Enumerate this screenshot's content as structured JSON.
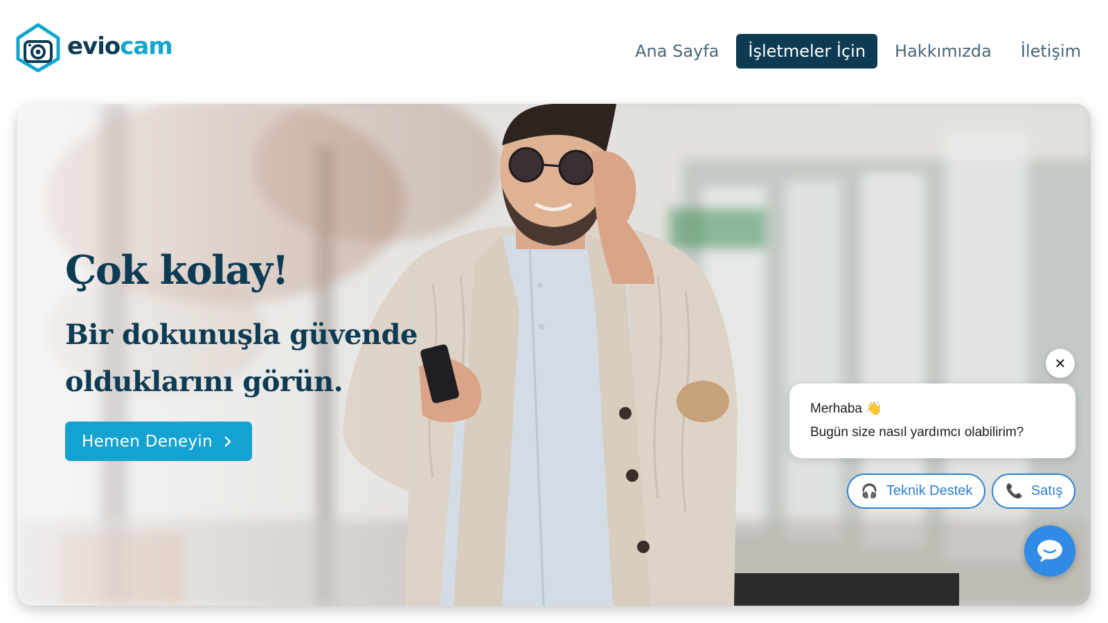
{
  "brand": {
    "name_part1": "evio",
    "name_part2": "cam",
    "primary_color": "#0d3b54",
    "accent_color": "#14a5cf"
  },
  "nav": {
    "items": [
      {
        "label": "Ana Sayfa",
        "active": false
      },
      {
        "label": "İşletmeler İçin",
        "active": true
      },
      {
        "label": "Hakkımızda",
        "active": false
      },
      {
        "label": "İletişim",
        "active": false
      }
    ]
  },
  "hero": {
    "headline": "Çok kolay!",
    "subhead": "Bir dokunuşla güvende olduklarını görün.",
    "cta_label": "Hemen Deneyin",
    "cta_icon": "chevron-right-icon"
  },
  "chat": {
    "close_icon": "close-icon",
    "greeting": "Merhaba 👋",
    "message": "Bugün size nasıl yardımcı olabilirim?",
    "buttons": [
      {
        "label": "Teknik Destek",
        "icon": "headphones-icon"
      },
      {
        "label": "Satış",
        "icon": "phone-icon"
      }
    ],
    "launcher_icon": "chat-bubble-icon",
    "button_color": "#2c7fd6"
  }
}
